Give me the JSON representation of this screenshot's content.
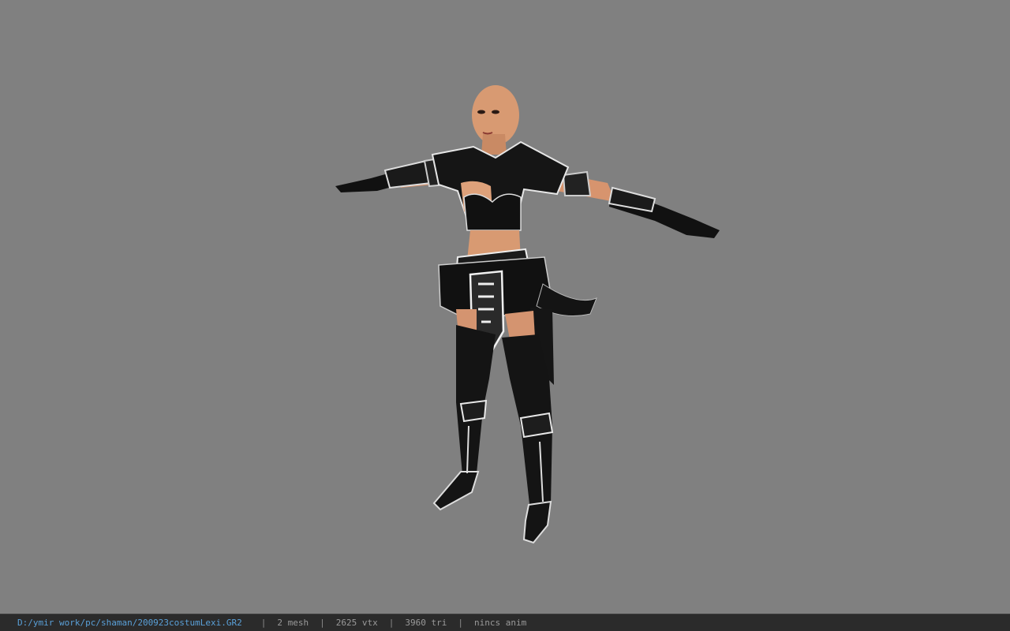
{
  "viewer": {
    "background_color": "#808080",
    "model_name": "costume character model"
  },
  "statusbar": {
    "file_path": "D:/ymir work/pc/shaman/200923costumLexi.GR2",
    "separator": "|",
    "mesh_count": "2 mesh",
    "vertex_count": "2625 vtx",
    "triangle_count": "3960 tri",
    "animation": "nincs anim"
  },
  "colors": {
    "statusbar_bg": "#2b2b2b",
    "path_text": "#5aa0d8",
    "info_text": "#9a9a9a"
  }
}
